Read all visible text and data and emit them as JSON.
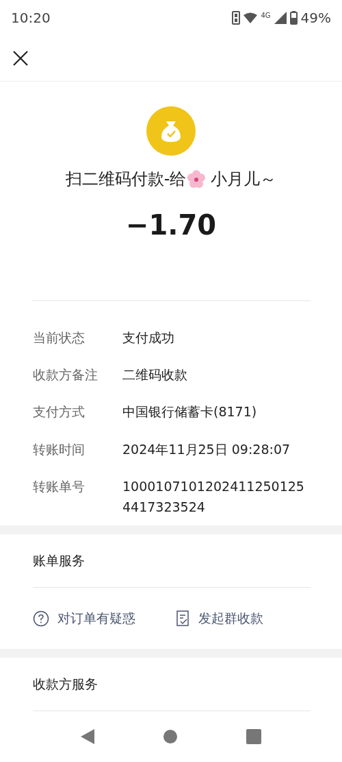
{
  "status_bar": {
    "time": "10:20",
    "battery": "49%",
    "network": "4G"
  },
  "payment": {
    "title_before": "扫二维码付款-给",
    "title_after": "小月儿～",
    "amount": "−1.70"
  },
  "details": [
    {
      "label": "当前状态",
      "value": "支付成功"
    },
    {
      "label": "收款方备注",
      "value": "二维码收款"
    },
    {
      "label": "支付方式",
      "value": "中国银行储蓄卡(8171)"
    },
    {
      "label": "转账时间",
      "value": "2024年11月25日 09:28:07"
    },
    {
      "label": "转账单号",
      "value": "10001071012024112501254417323524"
    }
  ],
  "bill_services": {
    "title": "账单服务",
    "actions": [
      {
        "kind": "question",
        "label": "对订单有疑惑"
      },
      {
        "kind": "receipt",
        "label": "发起群收款"
      }
    ]
  },
  "payee_services": {
    "title": "收款方服务"
  }
}
